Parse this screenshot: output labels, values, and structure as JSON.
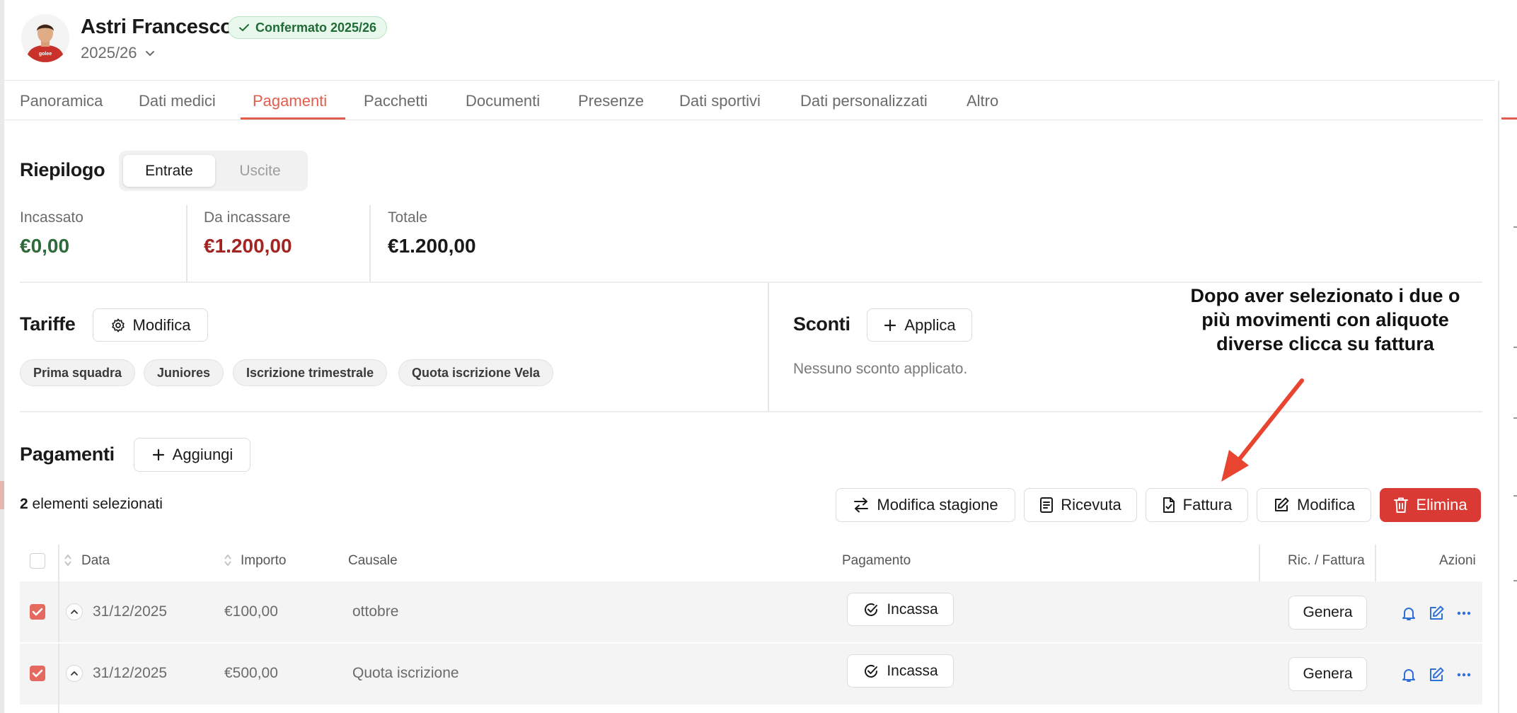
{
  "header": {
    "name": "Astri Francesco",
    "status_badge": "Confermato 2025/26",
    "season": "2025/26",
    "status_color": "#1f6b35"
  },
  "tabs": [
    "Panoramica",
    "Dati medici",
    "Pagamenti",
    "Pacchetti",
    "Documenti",
    "Presenze",
    "Dati sportivi",
    "Dati personalizzati",
    "Altro"
  ],
  "active_tab": "Pagamenti",
  "summary": {
    "title": "Riepilogo",
    "toggle": [
      "Entrate",
      "Uscite"
    ],
    "active_toggle": "Entrate",
    "stats": [
      {
        "label": "Incassato",
        "value": "€0,00",
        "color": "#2f6b3a"
      },
      {
        "label": "Da incassare",
        "value": "€1.200,00",
        "color": "#a32420"
      },
      {
        "label": "Totale",
        "value": "€1.200,00",
        "color": "#1a1a1a"
      }
    ]
  },
  "tariffe": {
    "title": "Tariffe",
    "button": "Modifica",
    "chips": [
      "Prima squadra",
      "Juniores",
      "Iscrizione trimestrale",
      "Quota iscrizione Vela"
    ]
  },
  "sconti": {
    "title": "Sconti",
    "button": "Applica",
    "empty": "Nessuno sconto applicato."
  },
  "annotation": {
    "text": "Dopo aver selezionato i due o più movimenti con aliquote diverse clicca su fattura",
    "color": "#e8442f"
  },
  "payments": {
    "title": "Pagamenti",
    "add_button": "Aggiungi",
    "selected_count": "2",
    "selected_text": "elementi selezionati",
    "actions": {
      "season": "Modifica stagione",
      "receipt": "Ricevuta",
      "invoice": "Fattura",
      "edit": "Modifica",
      "delete": "Elimina"
    },
    "columns": {
      "date": "Data",
      "amount": "Importo",
      "reason": "Causale",
      "payment": "Pagamento",
      "invoice": "Ric. / Fattura",
      "actions": "Azioni"
    },
    "rows": [
      {
        "date": "31/12/2025",
        "amount": "€100,00",
        "reason": "ottobre",
        "pay_button": "Incassa",
        "gen_button": "Genera"
      },
      {
        "date": "31/12/2025",
        "amount": "€500,00",
        "reason": "Quota iscrizione",
        "pay_button": "Incassa",
        "gen_button": "Genera"
      }
    ]
  }
}
